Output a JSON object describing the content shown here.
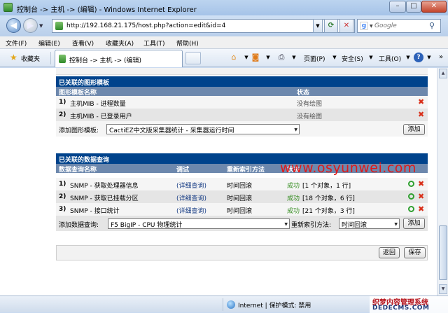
{
  "window": {
    "title": "控制台 -> 主机 -> (编辑) - Windows Internet Explorer",
    "min_glyph": "–",
    "max_glyph": "□",
    "close_glyph": "✕"
  },
  "address": {
    "url": "http://192.168.21.175/host.php?action=edit&id=4",
    "search_placeholder": "Google"
  },
  "menu": [
    "文件(F)",
    "编辑(E)",
    "查看(V)",
    "收藏夹(A)",
    "工具(T)",
    "帮助(H)"
  ],
  "favorites": {
    "label": "收藏夹",
    "tab_title": "控制台 -> 主机 -> (编辑)"
  },
  "commands": {
    "page": "页面(P)",
    "safety": "安全(S)",
    "tools": "工具(O)"
  },
  "graph_templates": {
    "header": "已关联的图形模板",
    "col_name": "图形模板名称",
    "col_status": "状态",
    "rows": [
      {
        "num": "1)",
        "name": "主机MIB - 进程数量",
        "status": "没有绘图"
      },
      {
        "num": "2)",
        "name": "主机MIB - 已登录用户",
        "status": "没有绘图"
      }
    ],
    "add_label": "添加图形模板:",
    "add_select": "CactiEZ中文版采集器统计 - 采集器运行时间",
    "add_button": "添加"
  },
  "data_queries": {
    "header": "已关联的数据查询",
    "col_name": "数据查询名称",
    "col_debug": "调试",
    "col_reindex": "重新索引方法",
    "col_status": "状态",
    "rows": [
      {
        "num": "1)",
        "name": "SNMP - 获取处理器信息",
        "debug": "(详细查询)",
        "reindex": "时间回滚",
        "status_ok": "成功",
        "status_detail": "[1 个对象，1 行]"
      },
      {
        "num": "2)",
        "name": "SNMP - 获取已挂载分区",
        "debug": "(详细查询)",
        "reindex": "时间回滚",
        "status_ok": "成功",
        "status_detail": "[18 个对象，6 行]"
      },
      {
        "num": "3)",
        "name": "SNMP - 接口统计",
        "debug": "(详细查询)",
        "reindex": "时间回滚",
        "status_ok": "成功",
        "status_detail": "[21 个对象，3 行]"
      }
    ],
    "add_label": "添加数据查询:",
    "add_select": "F5 BigIP - CPU 物理统计",
    "reindex_label": "重新索引方法:",
    "reindex_select": "时间回滚",
    "add_button": "添加"
  },
  "footer": {
    "back_button": "返回",
    "save_button": "保存"
  },
  "watermark": "www.osyunwei.com",
  "statusbar": {
    "zone": "Internet | 保护模式: 禁用",
    "brand_cn": "织梦内容管理系统",
    "brand_en": "DEDECMS.COM"
  }
}
